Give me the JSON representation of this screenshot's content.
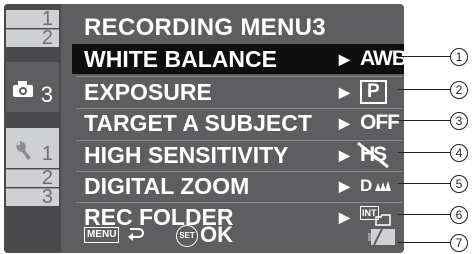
{
  "menu": {
    "title": "RECORDING MENU",
    "title_page": "3"
  },
  "tabs": [
    {
      "label": "1",
      "icon": "camera-icon"
    },
    {
      "label": "2",
      "icon": "camera-icon"
    },
    {
      "label": "3",
      "icon": "camera-icon",
      "active": true
    },
    {
      "label": "1",
      "icon": "wrench-icon"
    },
    {
      "label": "2",
      "icon": "wrench-icon"
    },
    {
      "label": "3",
      "icon": "wrench-icon"
    }
  ],
  "items": [
    {
      "label": "WHITE BALANCE",
      "value": "AWB",
      "selected": true
    },
    {
      "label": "EXPOSURE",
      "value": "P"
    },
    {
      "label": "TARGET A SUBJECT",
      "value": "OFF"
    },
    {
      "label": "HIGH SENSITIVITY",
      "value": "HS"
    },
    {
      "label": "DIGITAL ZOOM",
      "value": "D"
    },
    {
      "label": "REC FOLDER",
      "value": "INT"
    }
  ],
  "footer": {
    "menu_label": "MENU",
    "set_label": "SET",
    "ok_label": "OK"
  },
  "callouts": [
    "1",
    "2",
    "3",
    "4",
    "5",
    "6",
    "7"
  ],
  "colors": {
    "screen_bg": "#5e5e60",
    "selected_row": "#0f0f10",
    "tab_inactive": "#cfd0d2",
    "text": "#ffffff"
  }
}
